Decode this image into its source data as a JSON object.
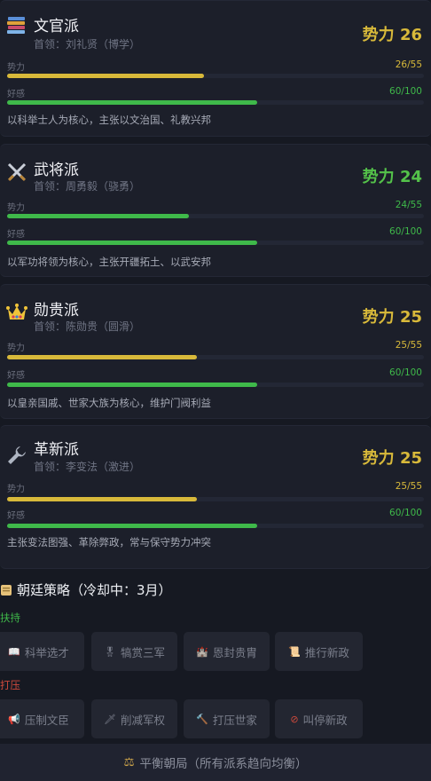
{
  "factions": [
    {
      "name": "文官派",
      "leader": "首领：刘礼贤（博学）",
      "power_label": "势力 26",
      "power_color": "#d8b93a",
      "influence_label": "势力",
      "influence_value": "26/55",
      "influence_ratio": 0.473,
      "favor_label": "好感",
      "favor_value": "60/100",
      "favor_ratio": 0.6,
      "description": "以科举士人为核心，主张以文治国、礼教兴邦",
      "icon": "books-icon"
    },
    {
      "name": "武将派",
      "leader": "首领：周勇毅（骁勇）",
      "power_label": "势力 24",
      "power_color": "#54c24a",
      "influence_label": "势力",
      "influence_value": "24/55",
      "influence_ratio": 0.436,
      "favor_label": "好感",
      "favor_value": "60/100",
      "favor_ratio": 0.6,
      "description": "以军功将领为核心，主张开疆拓土、以武安邦",
      "icon": "crossed-swords-icon"
    },
    {
      "name": "勋贵派",
      "leader": "首领：陈勋贵（圆滑）",
      "power_label": "势力 25",
      "power_color": "#d8b93a",
      "influence_label": "势力",
      "influence_value": "25/55",
      "influence_ratio": 0.455,
      "favor_label": "好感",
      "favor_value": "60/100",
      "favor_ratio": 0.6,
      "description": "以皇亲国戚、世家大族为核心，维护门阀利益",
      "icon": "crown-icon"
    },
    {
      "name": "革新派",
      "leader": "首领：李变法（激进）",
      "power_label": "势力 25",
      "power_color": "#d8b93a",
      "influence_label": "势力",
      "influence_value": "25/55",
      "influence_ratio": 0.455,
      "favor_label": "好感",
      "favor_value": "60/100",
      "favor_ratio": 0.6,
      "description": "主张变法图强、革除弊政，常与保守势力冲突",
      "icon": "wrench-icon"
    }
  ],
  "colors": {
    "influence_bar": "#d8b93a",
    "favor_bar": "#3fb94a",
    "favor_text": "#3fb94a",
    "influence_text": "#d8b93a",
    "support_label": "#3fb94a",
    "suppress_label": "#d04a3c"
  },
  "strategy": {
    "title": "朝廷策略（冷却中：3月）",
    "support_label": "扶持",
    "suppress_label": "打压",
    "support_buttons": [
      {
        "icon": "book-icon",
        "label": "科举选才"
      },
      {
        "icon": "medal-icon",
        "label": "犒赏三军"
      },
      {
        "icon": "castle-icon",
        "label": "恩封贵胄"
      },
      {
        "icon": "scroll-icon",
        "label": "推行新政"
      }
    ],
    "suppress_buttons": [
      {
        "icon": "megaphone-icon",
        "label": "压制文臣"
      },
      {
        "icon": "dagger-icon",
        "label": "削减军权"
      },
      {
        "icon": "hammer-icon",
        "label": "打压世家"
      },
      {
        "icon": "prohibited-icon",
        "label": "叫停新政"
      }
    ],
    "balance_label": "平衡朝局（所有派系趋向均衡）"
  }
}
